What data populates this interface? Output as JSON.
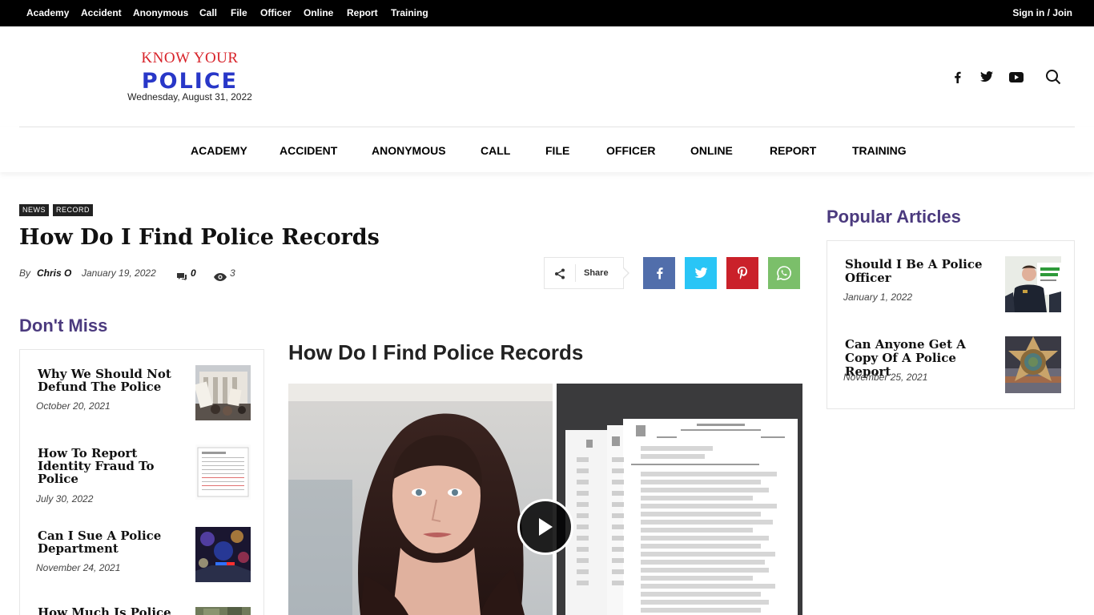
{
  "topbar": {
    "links": [
      "Academy",
      "Accident",
      "Anonymous",
      "Call",
      "File",
      "Officer",
      "Online",
      "Report",
      "Training"
    ],
    "signin": "Sign in / Join"
  },
  "header": {
    "logo_top": "KNOW YOUR",
    "logo_bottom": "POLICE",
    "date": "Wednesday, August 31, 2022",
    "social_icons": [
      "facebook-icon",
      "twitter-icon",
      "youtube-icon"
    ],
    "search_icon": "search-icon"
  },
  "mainnav": {
    "links": [
      "ACADEMY",
      "ACCIDENT",
      "ANONYMOUS",
      "CALL",
      "FILE",
      "OFFICER",
      "ONLINE",
      "REPORT",
      "TRAINING"
    ]
  },
  "article": {
    "tags": [
      "NEWS",
      "RECORD"
    ],
    "title": "How Do I Find Police Records",
    "by": "By",
    "author": "Chris O",
    "date": "January 19, 2022",
    "comments": "0",
    "views": "3",
    "share_label": "Share",
    "share_buttons": [
      {
        "name": "facebook-share-button",
        "color": "#516eab"
      },
      {
        "name": "twitter-share-button",
        "color": "#29c5f6"
      },
      {
        "name": "pinterest-share-button",
        "color": "#ca212a"
      },
      {
        "name": "whatsapp-share-button",
        "color": "#7bbf6a"
      }
    ]
  },
  "dont_miss": {
    "title": "Don't Miss",
    "items": [
      {
        "title": "Why We Should Not Defund The Police",
        "date": "October 20, 2021"
      },
      {
        "title": "How To Report Identity Fraud To Police",
        "date": "July 30, 2022"
      },
      {
        "title": "Can I Sue A Police Department",
        "date": "November 24, 2021"
      },
      {
        "title": "How Much Is Police",
        "date": ""
      }
    ]
  },
  "video": {
    "title": "How Do I Find Police Records"
  },
  "popular": {
    "title": "Popular Articles",
    "items": [
      {
        "title": "Should I Be A Police Officer",
        "date": "January 1, 2022"
      },
      {
        "title": "Can Anyone Get A Copy Of A Police Report",
        "date": "November 25, 2021"
      }
    ]
  },
  "colors": {
    "accent_purple": "#4b3a7e",
    "logo_red": "#d8232a",
    "logo_blue": "#2837c8",
    "topbar": "#000000"
  }
}
